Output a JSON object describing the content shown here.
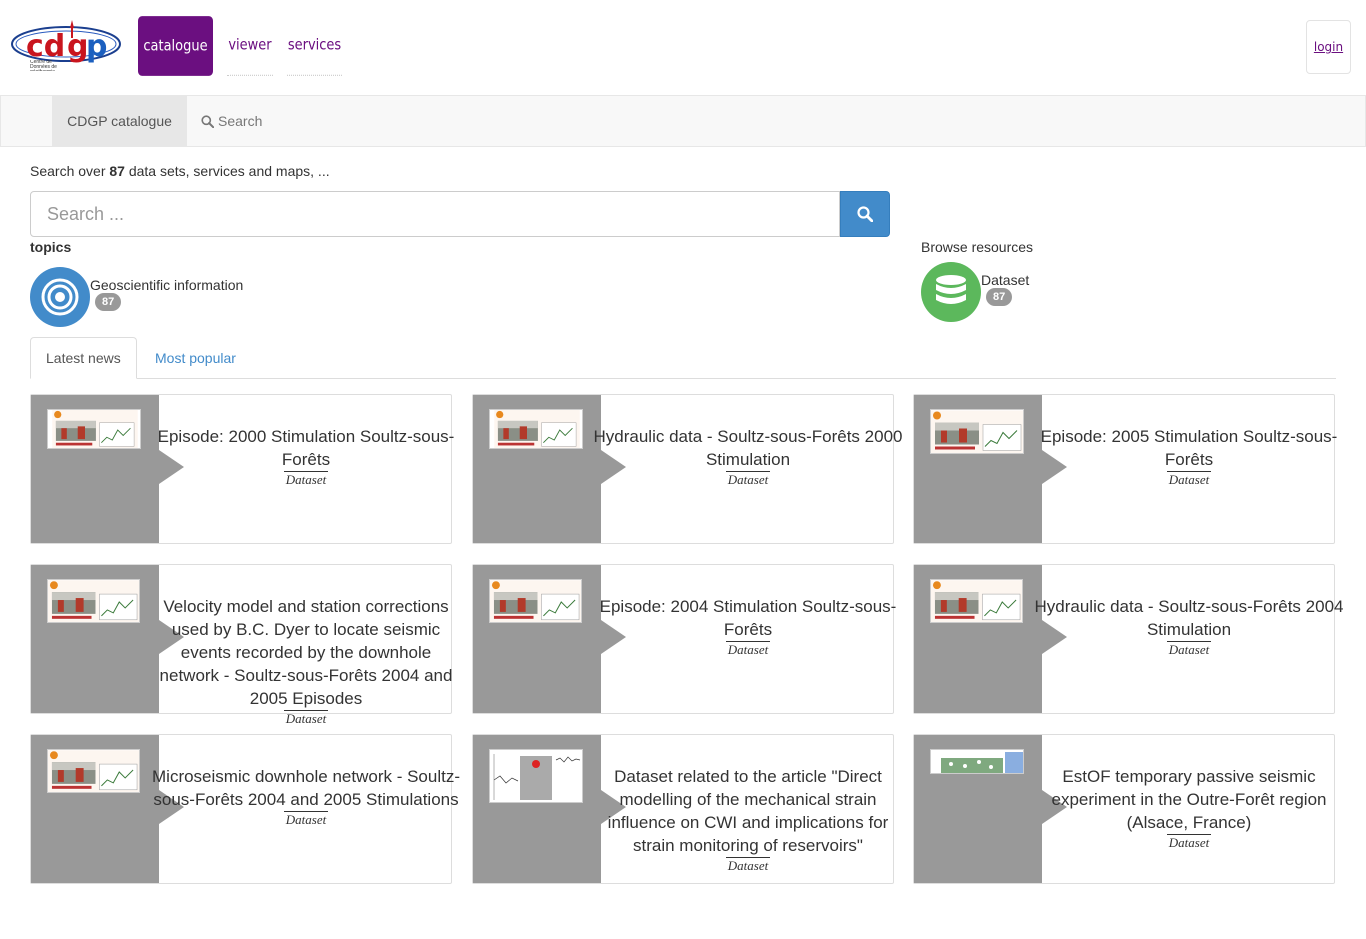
{
  "header": {
    "logo_text": "cdgp",
    "logo_subtitle": "Centre de Données de géothermie profonde",
    "nav": [
      {
        "label": "catalogue"
      },
      {
        "label": "viewer"
      },
      {
        "label": "services"
      }
    ],
    "login_label": "login",
    "colors": {
      "brand": "#6b0f80"
    }
  },
  "subnav": {
    "catalogue_label": "CDGP catalogue",
    "search_label": "Search"
  },
  "search": {
    "intro_prefix": "Search over",
    "count": "87",
    "intro_suffix": "data sets, services and maps, ...",
    "placeholder": "Search ...",
    "button_icon": "search-icon"
  },
  "topics": {
    "title": "topics",
    "items": [
      {
        "label": "Geoscientific information",
        "count": "87",
        "icon": "target-icon",
        "color": "#428bca"
      }
    ]
  },
  "browse": {
    "title": "Browse resources",
    "items": [
      {
        "label": "Dataset",
        "count": "87",
        "icon": "database-icon",
        "color": "#5cb85c"
      }
    ]
  },
  "tabs": [
    {
      "label": "Latest news",
      "active": true
    },
    {
      "label": "Most popular",
      "active": false
    }
  ],
  "cards": [
    {
      "title": "Episode: 2000 Stimulation Soultz-sous-Forêts",
      "type": "Dataset"
    },
    {
      "title": "Hydraulic data - Soultz-sous-Forêts 2000 Stimulation",
      "type": "Dataset"
    },
    {
      "title": "Episode: 2005 Stimulation Soultz-sous-Forêts",
      "type": "Dataset"
    },
    {
      "title": "Velocity model and station corrections used by B.C. Dyer to locate seismic events recorded by the downhole network - Soultz-sous-Forêts 2004 and 2005 Episodes",
      "type": "Dataset"
    },
    {
      "title": "Episode: 2004 Stimulation Soultz-sous-Forêts",
      "type": "Dataset"
    },
    {
      "title": "Hydraulic data - Soultz-sous-Forêts 2004 Stimulation",
      "type": "Dataset"
    },
    {
      "title": "Microseismic downhole network - Soultz-sous-Forêts 2004 and 2005 Stimulations",
      "type": "Dataset"
    },
    {
      "title": "Dataset related to the article \"Direct modelling of the mechanical strain influence on CWI and implications for strain monitoring of reservoirs\"",
      "type": "Dataset"
    },
    {
      "title": "EstOF temporary passive seismic experiment in the Outre-Forêt region (Alsace, France)",
      "type": "Dataset"
    }
  ]
}
